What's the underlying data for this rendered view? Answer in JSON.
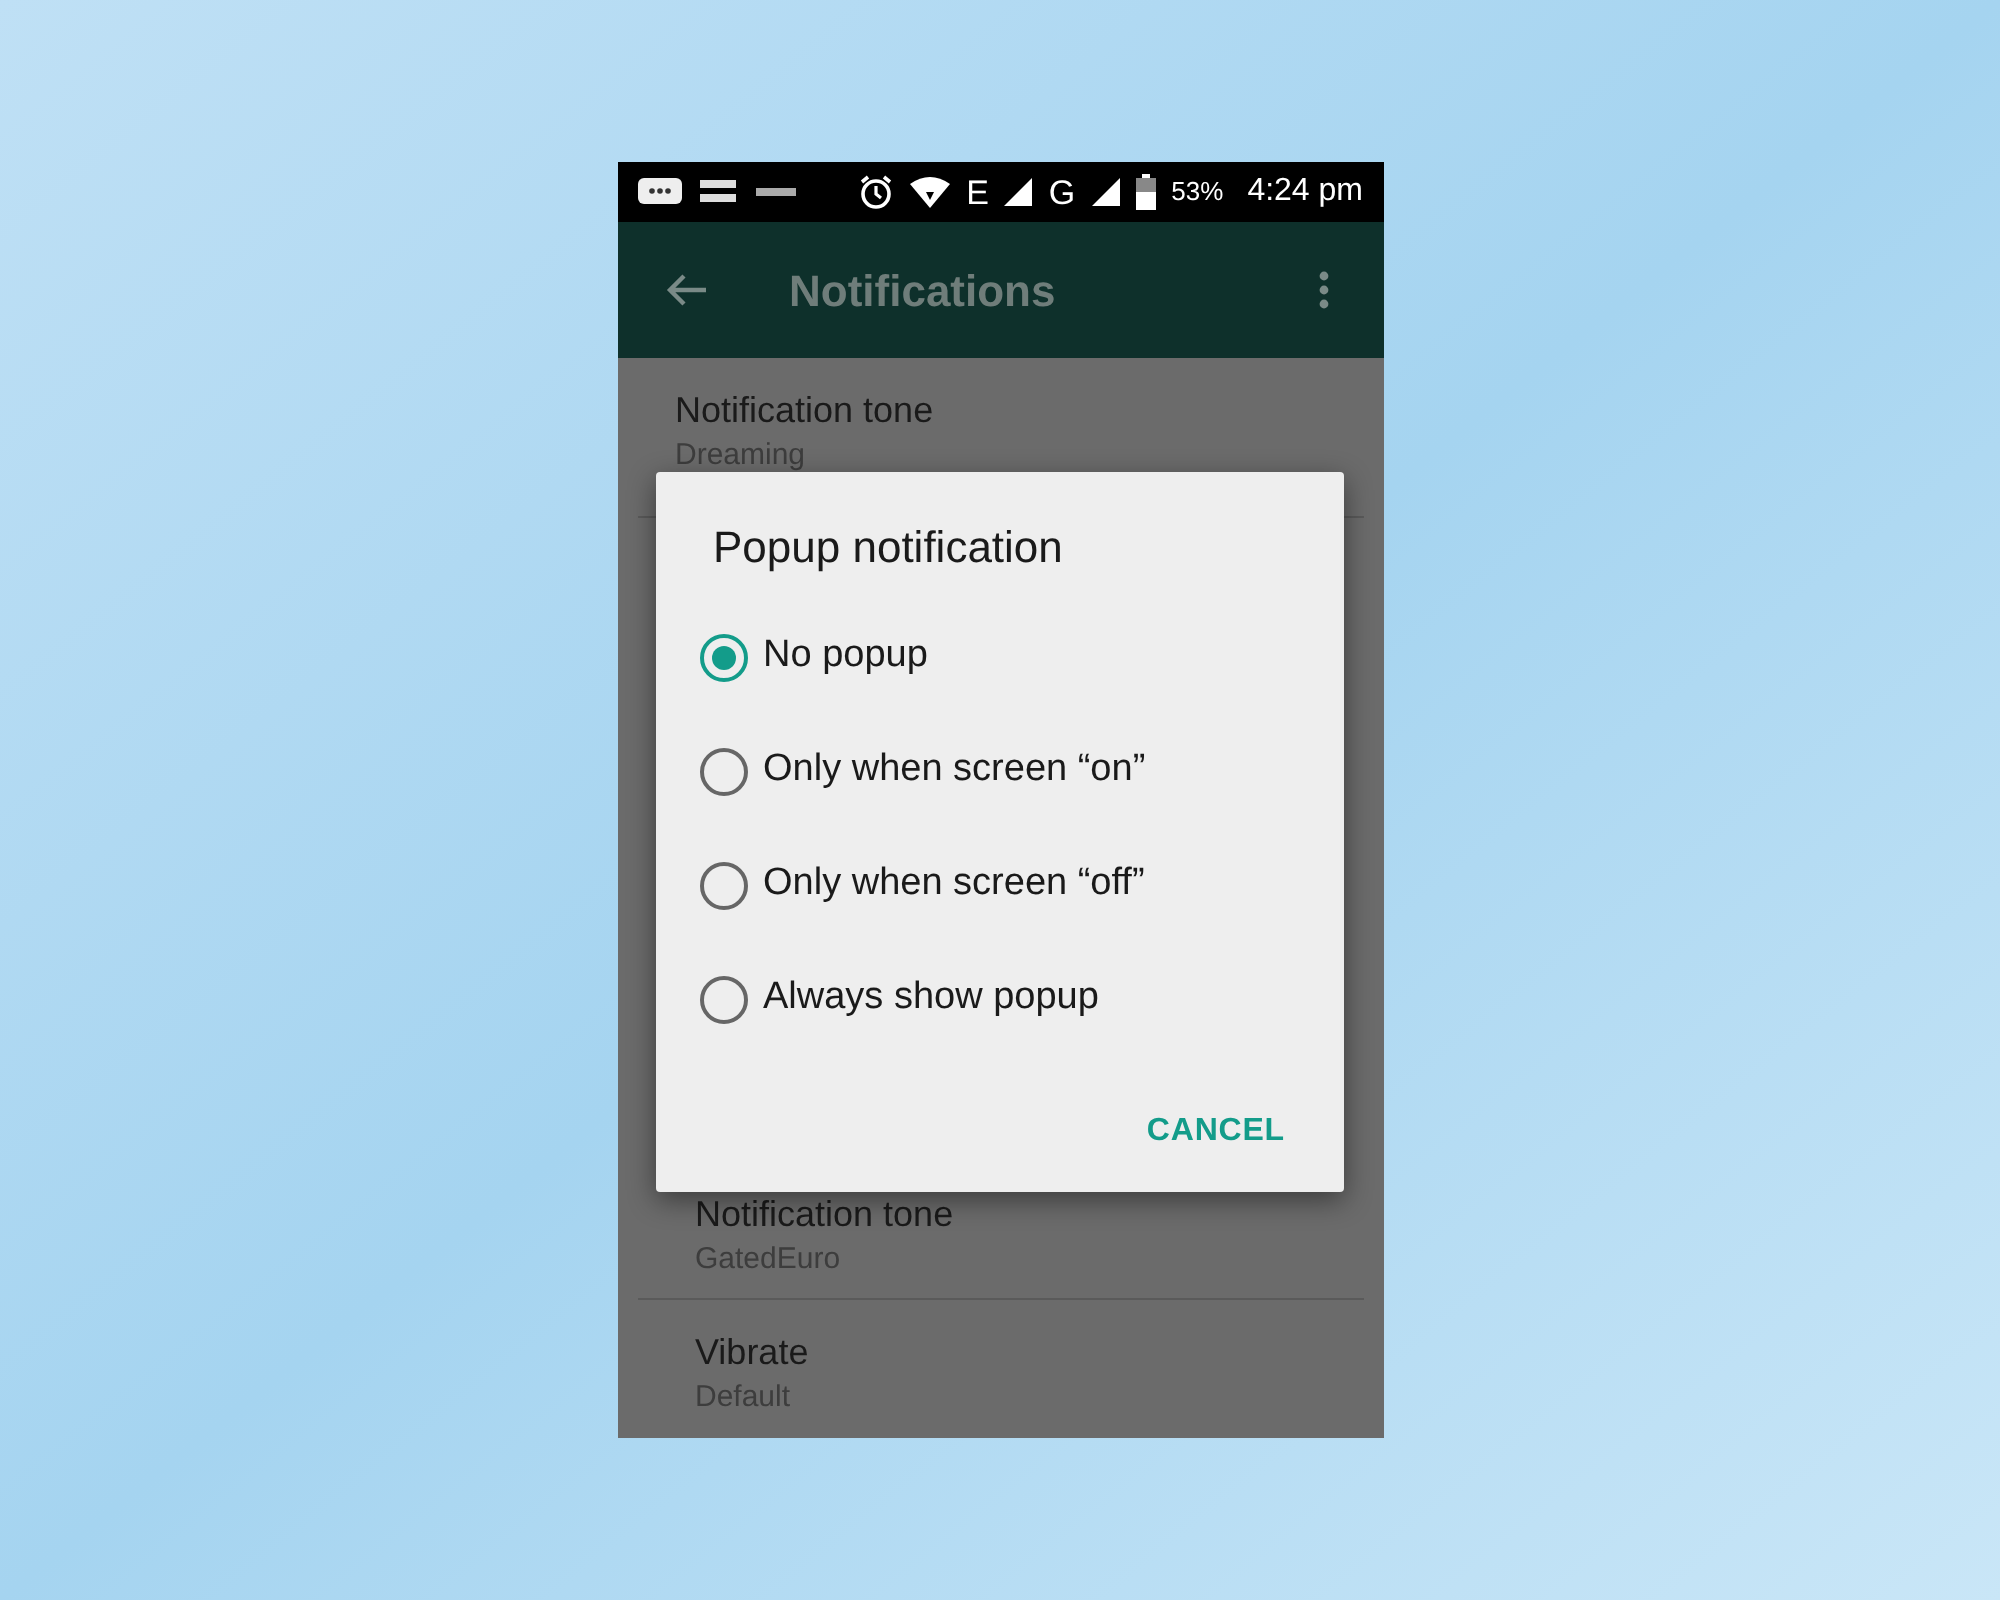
{
  "status_bar": {
    "network_1": "E",
    "network_2": "G",
    "battery": "53%",
    "time": "4:24 pm"
  },
  "app_bar": {
    "title": "Notifications"
  },
  "settings": [
    {
      "title": "Notification tone",
      "value": "Dreaming"
    },
    {
      "title": "Notification tone",
      "value": "GatedEuro"
    },
    {
      "title": "Vibrate",
      "value": "Default"
    }
  ],
  "dialog": {
    "title": "Popup notification",
    "options": [
      {
        "label": "No popup",
        "selected": true
      },
      {
        "label": "Only when screen “on”",
        "selected": false
      },
      {
        "label": "Only when screen “off”",
        "selected": false
      },
      {
        "label": "Always show popup",
        "selected": false
      }
    ],
    "buttons": [
      "CANCEL"
    ]
  }
}
